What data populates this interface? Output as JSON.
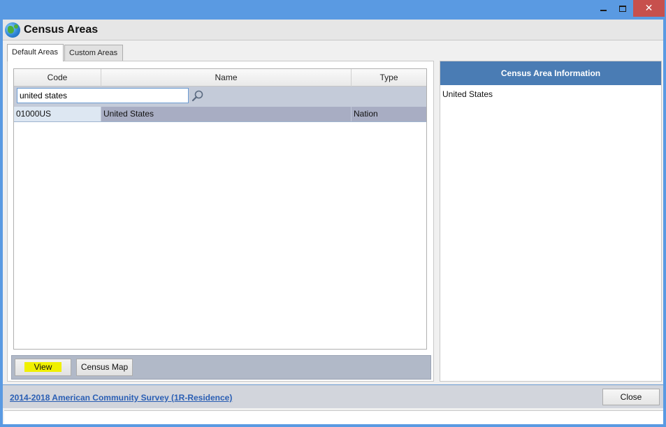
{
  "window": {
    "close_glyph": "✕"
  },
  "header": {
    "title": "Census Areas",
    "icon": "globe-icon"
  },
  "tabs": [
    {
      "label": "Default Areas",
      "active": true
    },
    {
      "label": "Custom Areas",
      "active": false
    }
  ],
  "grid": {
    "columns": [
      "Code",
      "Name",
      "Type"
    ],
    "filter_value": "united states",
    "rows": [
      {
        "code": "01000US",
        "name": "United States",
        "type": "Nation"
      }
    ]
  },
  "buttons": {
    "view_label": "View",
    "map_label": "Census Map"
  },
  "info": {
    "title": "Census Area Information",
    "body": "United States"
  },
  "footer": {
    "survey_link": "2014-2018 American Community Survey (1R-Residence)",
    "close_label": "Close"
  },
  "colors": {
    "title_bar": "#5a9ae2",
    "info_header": "#4a7cb4",
    "selected_row": "#a8adc3",
    "highlight": "#f0f000",
    "close_button": "#c7504d"
  }
}
